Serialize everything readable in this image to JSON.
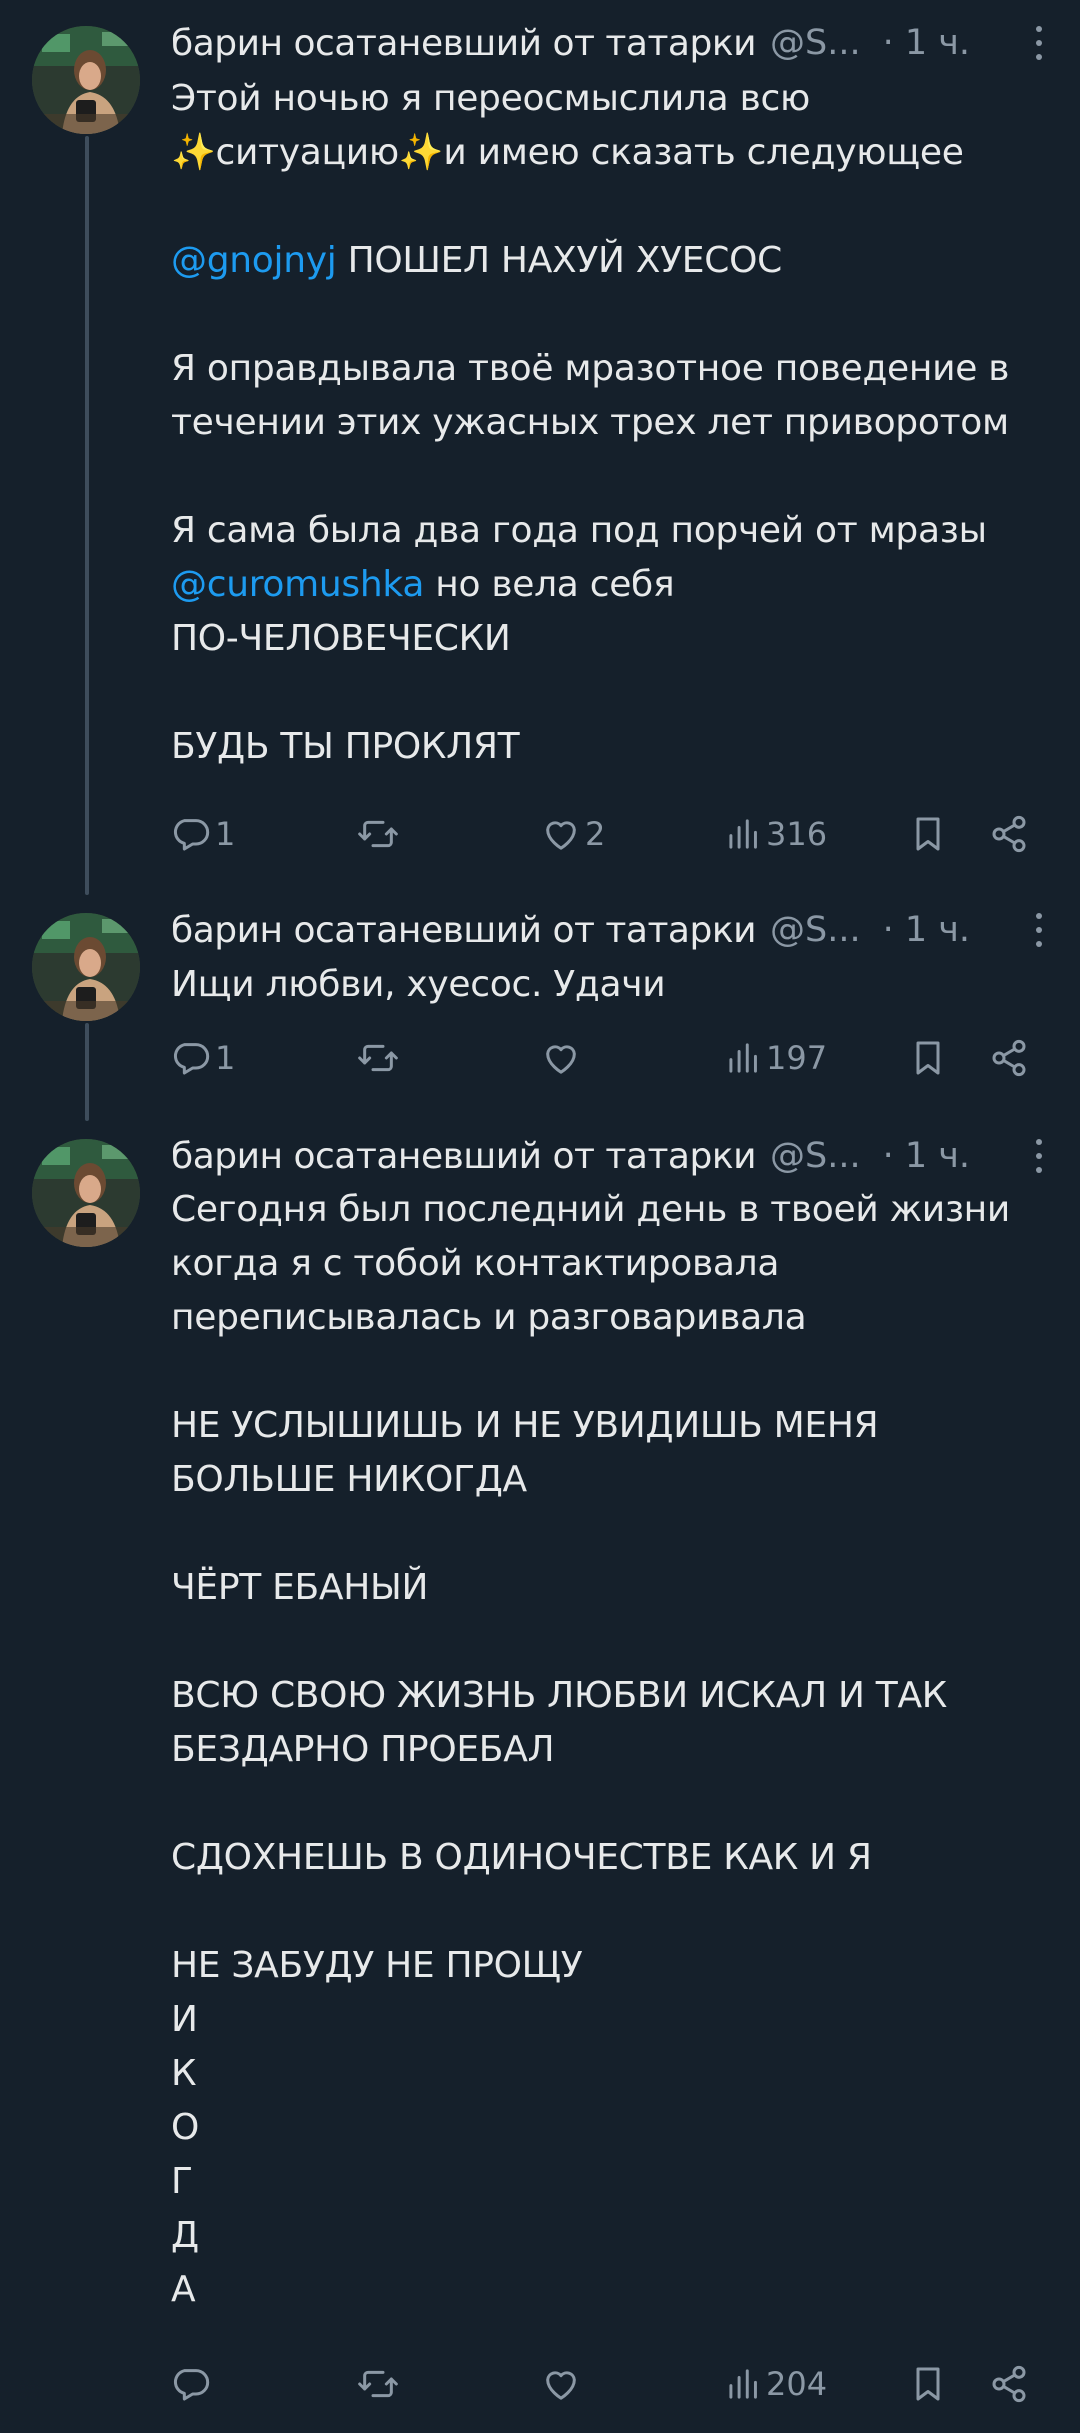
{
  "thread": {
    "author_name": "барин осатаневший от татарки",
    "handle": "@S...",
    "time": "· 1 ч.",
    "tweets": [
      {
        "lines": [
          [
            "Этой ночью я переосмыслила всю"
          ],
          [
            "✨ситуацию✨и имею сказать следующее"
          ],
          [],
          [
            "@gnojnyj",
            " ПОШЕЛ НАХУЙ ХУЕСОС"
          ],
          [],
          [
            "Я оправдывала твоё мразотное поведение в"
          ],
          [
            "течении этих ужасных трех лет приворотом"
          ],
          [],
          [
            "Я сама была два года под порчей от мразы"
          ],
          [
            "@curomushka",
            " но вела себя"
          ],
          [
            "ПО-ЧЕЛОВЕЧЕСКИ"
          ],
          [],
          [
            "БУДЬ ТЫ ПРОКЛЯТ"
          ]
        ],
        "replies": "1",
        "retweets": "",
        "likes": "2",
        "views": "316"
      },
      {
        "lines": [
          [
            "Ищи любви, хуесос. Удачи"
          ]
        ],
        "replies": "1",
        "retweets": "",
        "likes": "",
        "views": "197"
      },
      {
        "lines": [
          [
            "Сегодня был последний день в твоей жизни"
          ],
          [
            "когда я с тобой контактировала"
          ],
          [
            "переписывалась и разговаривала"
          ],
          [],
          [
            "НЕ УСЛЫШИШЬ И НЕ УВИДИШЬ МЕНЯ"
          ],
          [
            "БОЛЬШЕ НИКОГДА"
          ],
          [],
          [
            "ЧЁРТ ЕБАНЫЙ"
          ],
          [],
          [
            "ВСЮ СВОЮ ЖИЗНЬ ЛЮБВИ ИСКАЛ И ТАК"
          ],
          [
            "БЕЗДАРНО ПРОЕБАЛ"
          ],
          [],
          [
            "СДОХНЕШЬ В ОДИНОЧЕСТВЕ КАК И Я"
          ],
          [],
          [
            "НЕ ЗАБУДУ НЕ ПРОЩУ"
          ],
          [
            "И"
          ],
          [
            "К"
          ],
          [
            "О"
          ],
          [
            "Г"
          ],
          [
            "Д"
          ],
          [
            "А"
          ]
        ],
        "replies": "",
        "retweets": "",
        "likes": "",
        "views": "204"
      }
    ]
  },
  "colors": {
    "background": "#15202b",
    "text": "#e7e9ea",
    "secondary": "#8b98a5",
    "link": "#1d9bf0",
    "thread_line": "#3e4d5c"
  }
}
